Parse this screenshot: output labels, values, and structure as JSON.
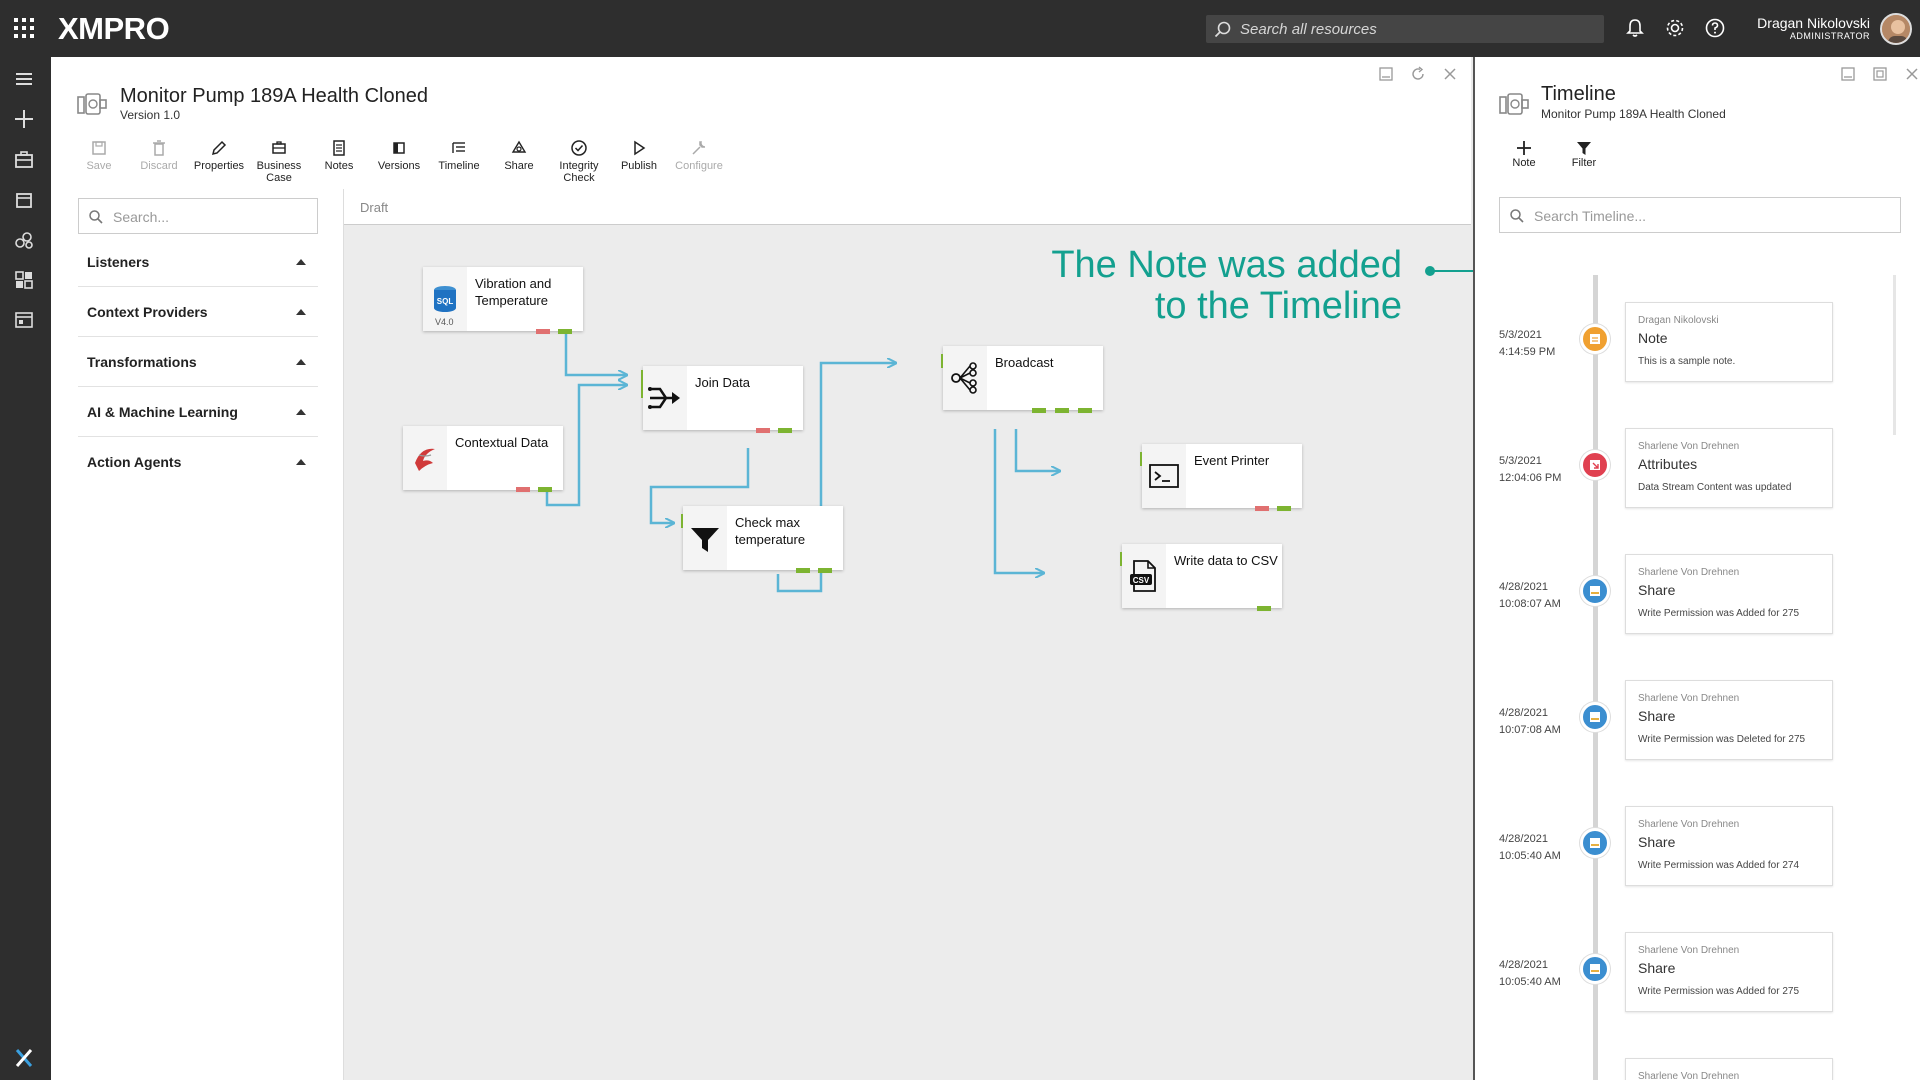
{
  "topbar": {
    "brand": "XMPRO",
    "search_placeholder": "Search all resources",
    "user_name": "Dragan Nikolovski",
    "user_role": "ADMINISTRATOR"
  },
  "designer": {
    "title": "Monitor Pump 189A Health Cloned",
    "version": "Version 1.0",
    "tools": [
      {
        "label": "Save",
        "icon": "save-icon",
        "enabled": false
      },
      {
        "label": "Discard",
        "icon": "trash-icon",
        "enabled": false
      },
      {
        "label": "Properties",
        "icon": "pencil-icon",
        "enabled": true
      },
      {
        "label": "Business Case",
        "icon": "briefcase-icon",
        "enabled": true
      },
      {
        "label": "Notes",
        "icon": "notes-icon",
        "enabled": true
      },
      {
        "label": "Versions",
        "icon": "versions-icon",
        "enabled": true
      },
      {
        "label": "Timeline",
        "icon": "timeline-icon",
        "enabled": true
      },
      {
        "label": "Share",
        "icon": "share-icon",
        "enabled": true
      },
      {
        "label": "Integrity Check",
        "icon": "check-circle-icon",
        "enabled": true
      },
      {
        "label": "Publish",
        "icon": "play-icon",
        "enabled": true
      },
      {
        "label": "Configure",
        "icon": "wrench-icon",
        "enabled": false
      }
    ],
    "search_placeholder": "Search...",
    "categories": [
      "Listeners",
      "Context Providers",
      "Transformations",
      "AI & Machine Learning",
      "Action Agents"
    ],
    "canvas_status": "Draft",
    "nodes": {
      "vibration": {
        "label": "Vibration and Temperature",
        "version": "V4.0"
      },
      "contextual": {
        "label": "Contextual Data"
      },
      "join": {
        "label": "Join Data"
      },
      "check": {
        "label": "Check max temperature"
      },
      "broadcast": {
        "label": "Broadcast"
      },
      "printer": {
        "label": "Event Printer"
      },
      "csv": {
        "label": "Write data to CSV"
      }
    },
    "annotation_line1": "The Note was added",
    "annotation_line2": "to the Timeline",
    "accent_color": "#13a08f",
    "connector_color": "#5bb5d5"
  },
  "timeline": {
    "title": "Timeline",
    "subtitle": "Monitor Pump 189A Health Cloned",
    "note_label": "Note",
    "filter_label": "Filter",
    "search_placeholder": "Search Timeline...",
    "entries": [
      {
        "date": "5/3/2021",
        "time": "4:14:59 PM",
        "user": "Dragan Nikolovski",
        "type": "Note",
        "desc": "This is a sample note.",
        "icon": "note-icon",
        "color": "#f0a030"
      },
      {
        "date": "5/3/2021",
        "time": "12:04:06 PM",
        "user": "Sharlene Von Drehnen",
        "type": "Attributes",
        "desc": "Data Stream Content was updated",
        "icon": "attributes-icon",
        "color": "#e04050"
      },
      {
        "date": "4/28/2021",
        "time": "10:08:07 AM",
        "user": "Sharlene Von Drehnen",
        "type": "Share",
        "desc": "Write Permission was Added for 275",
        "icon": "share-icon",
        "color": "#3b8ed0"
      },
      {
        "date": "4/28/2021",
        "time": "10:07:08 AM",
        "user": "Sharlene Von Drehnen",
        "type": "Share",
        "desc": "Write Permission was Deleted for 275",
        "icon": "share-icon",
        "color": "#3b8ed0"
      },
      {
        "date": "4/28/2021",
        "time": "10:05:40 AM",
        "user": "Sharlene Von Drehnen",
        "type": "Share",
        "desc": "Write Permission was Added for 274",
        "icon": "share-icon",
        "color": "#3b8ed0"
      },
      {
        "date": "4/28/2021",
        "time": "10:05:40 AM",
        "user": "Sharlene Von Drehnen",
        "type": "Share",
        "desc": "Write Permission was Added for 275",
        "icon": "share-icon",
        "color": "#3b8ed0"
      },
      {
        "user": "Sharlene Von Drehnen"
      }
    ]
  }
}
